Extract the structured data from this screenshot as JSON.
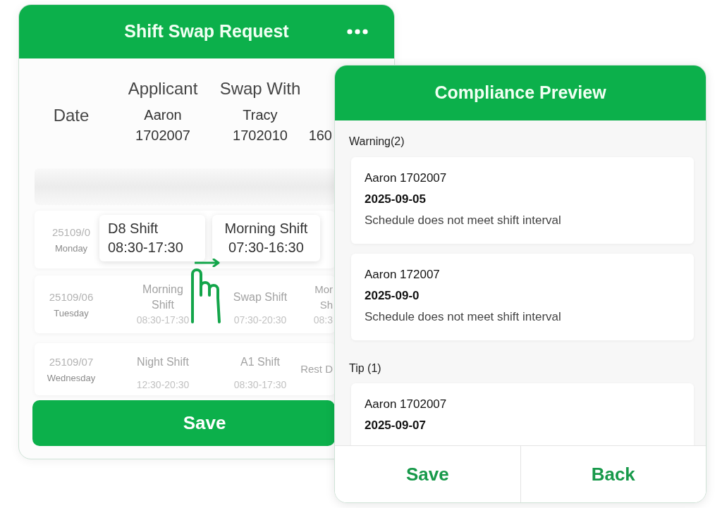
{
  "shift_swap_request": {
    "title": "Shift Swap Request",
    "date_label": "Date",
    "people": [
      {
        "label": "Applicant",
        "name": "Aaron",
        "id": "1702007"
      },
      {
        "label": "Swap With",
        "name": "Tracy",
        "id": "1702010"
      },
      {
        "id": "160"
      }
    ],
    "rows": [
      {
        "date": "25109/0",
        "weekday": "Monday"
      },
      {
        "date": "25109/06",
        "weekday": "Tuesday",
        "cells": [
          {
            "shift": [
              "Morning",
              "Shift"
            ],
            "time": "08:30-17:30"
          },
          {
            "shift": [
              "Swap Shift"
            ],
            "time": "07:30-20:30"
          },
          {
            "shift": [
              "Mor",
              "Sh"
            ],
            "time": "08:3"
          }
        ]
      },
      {
        "date": "25109/07",
        "weekday": "Wednesday",
        "cells": [
          {
            "shift": [
              "Night Shift"
            ],
            "time": "12:30-20:30"
          },
          {
            "shift": [
              "A1 Shift"
            ],
            "time": "08:30-17:30"
          },
          {
            "shift": [
              "Rest D"
            ]
          }
        ]
      }
    ],
    "swap_preview": {
      "from": {
        "shift": "D8 Shift",
        "time": "08:30-17:30"
      },
      "to": {
        "shift": "Morning Shift",
        "time": "07:30-16:30"
      }
    },
    "save_button": "Save"
  },
  "compliance_preview": {
    "title": "Compliance Preview",
    "sections": [
      {
        "heading": "Warning(2)",
        "items": [
          {
            "person": "Aaron 1702007",
            "date": "2025-09-05",
            "message": "Schedule does not meet shift interval"
          },
          {
            "person": "Aaron 172007",
            "date": "2025-09-0",
            "message": "Schedule does not meet shift interval"
          }
        ]
      },
      {
        "heading": "Tip (1)",
        "items": [
          {
            "person": "Aaron 1702007",
            "date": "2025-09-07"
          }
        ]
      }
    ],
    "buttons": [
      "Save",
      "Back"
    ]
  }
}
